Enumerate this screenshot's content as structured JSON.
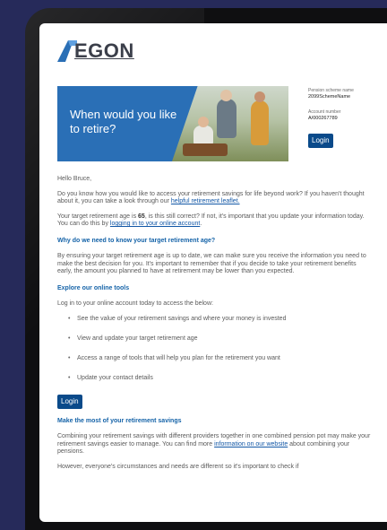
{
  "logo": {
    "text": "EGON",
    "accent_color": "#2a6fb6"
  },
  "hero": {
    "headline": "When would you like to retire?"
  },
  "account": {
    "scheme_label": "Pension scheme name",
    "scheme_value": "2099SchemeName",
    "number_label": "Account number",
    "number_value": "A/000267789",
    "login_label": "Login"
  },
  "email": {
    "greeting": "Hello Bruce,",
    "p1_text": "Do you know how you would like to access your retirement savings for life beyond work? If you haven't thought about it, you can take a look through our ",
    "p1_link": "helpful retirement leaflet.",
    "p2_a": "Your target retirement age is ",
    "p2_age": "65",
    "p2_b": ", is this still correct? If not, it's important that you update your information today. You can do this by ",
    "p2_link": "logging in to your online account",
    "p2_end": ".",
    "heading1": "Why do we need to know your target retirement age?",
    "p3": "By ensuring your target retirement age is up to date, we can make sure you receive the information you need to make the best decision for you. It's important to remember that if you decide to take your retirement benefits early, the amount you planned to have at retirement may be lower than you expected.",
    "heading2": "Explore our online tools",
    "p4": "Log in to your online account today to access the below:",
    "tools": [
      "See the value of your retirement savings and where your money is invested",
      "View and update your target retirement age",
      "Access a range of tools that will help you plan for the retirement you want",
      "Update your contact details"
    ],
    "login_label": "Login",
    "heading3": "Make the most of your retirement savings",
    "p5_text": "Combining your retirement savings with different providers together in one combined pension pot may make your retirement savings easier to manage. You can find more ",
    "p5_link": "information on our website",
    "p5_end": " about combining your pensions.",
    "p6": "However, everyone's circumstances and needs are different so it's important to check if"
  }
}
